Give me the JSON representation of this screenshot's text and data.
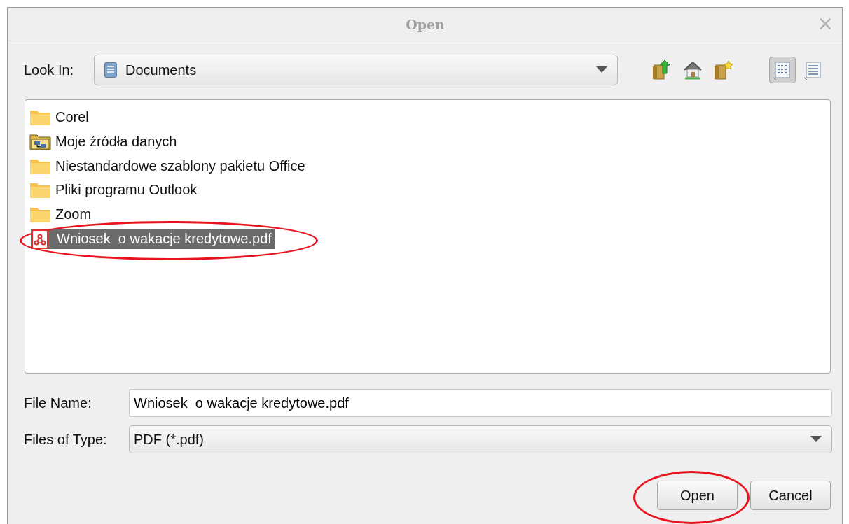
{
  "window": {
    "title": "Open",
    "close": "×"
  },
  "look_in": {
    "label": "Look In:",
    "value": "Documents"
  },
  "toolbar": [
    {
      "kind": "up",
      "selected": false
    },
    {
      "kind": "home",
      "selected": false
    },
    {
      "kind": "newfolder",
      "selected": false
    },
    {
      "kind": "list",
      "selected": true
    },
    {
      "kind": "details",
      "selected": false
    }
  ],
  "files": [
    {
      "kind": "folder",
      "name": "Corel",
      "selected": false,
      "circled": false
    },
    {
      "kind": "datasource",
      "name": "Moje źródła danych",
      "selected": false,
      "circled": false
    },
    {
      "kind": "folder",
      "name": "Niestandardowe szablony pakietu Office",
      "selected": false,
      "circled": false
    },
    {
      "kind": "folder",
      "name": "Pliki programu Outlook",
      "selected": false,
      "circled": false
    },
    {
      "kind": "folder",
      "name": "Zoom",
      "selected": false,
      "circled": false
    },
    {
      "kind": "pdf",
      "name": "Wniosek  o wakacje kredytowe.pdf",
      "selected": true,
      "circled": true
    }
  ],
  "file_name": {
    "label": "File Name:",
    "value": "Wniosek  o wakacje kredytowe.pdf"
  },
  "file_type": {
    "label": "Files of Type:",
    "value": "PDF (*.pdf)"
  },
  "buttons": [
    {
      "label": "Open",
      "circled": true
    },
    {
      "label": "Cancel",
      "circled": false
    }
  ]
}
